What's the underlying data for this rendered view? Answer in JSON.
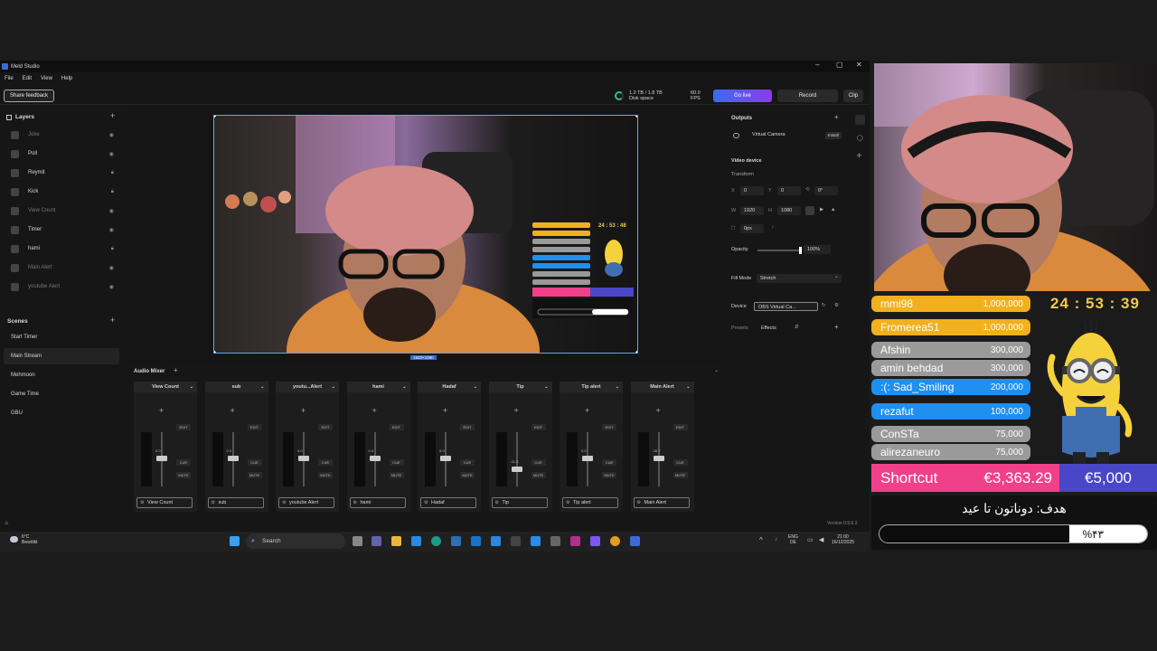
{
  "window": {
    "title": "Meld Studio",
    "min": "–",
    "max": "▢",
    "close": "✕"
  },
  "menu": [
    "File",
    "Edit",
    "View",
    "Help"
  ],
  "toolbar": {
    "share_feedback": "Share feedback",
    "disk_value": "1.2 TB / 1.8 TB",
    "disk_label": "Disk space",
    "fps_value": "60.0",
    "fps_label": "FPS",
    "go_live": "Go live",
    "record": "Record",
    "clip": "Clip"
  },
  "layers": {
    "title": "Layers",
    "items": [
      {
        "label": "Joke",
        "dim": true
      },
      {
        "label": "Poll",
        "dim": false
      },
      {
        "label": "Reymit",
        "dim": false,
        "lock": true
      },
      {
        "label": "Kick",
        "dim": false,
        "lock": true
      },
      {
        "label": "View Count",
        "dim": true
      },
      {
        "label": "Timer",
        "dim": false
      },
      {
        "label": "hami",
        "dim": false,
        "lock": true
      },
      {
        "label": "Main Alert",
        "dim": true
      },
      {
        "label": "youtube Alert",
        "dim": true
      }
    ]
  },
  "scenes": {
    "title": "Scenes",
    "items": [
      "Start Timer",
      "Main Stream",
      "Mehmoon",
      "Game Time",
      "GBU"
    ],
    "active_index": 1
  },
  "preview": {
    "size": "1920×1080",
    "timer": "24 : 53 : 48"
  },
  "mixer": {
    "title": "Audio Mixer",
    "edit": "EDIT",
    "cue": "CUE",
    "mute": "MUTE",
    "channels": [
      {
        "header": "View Count",
        "name": "View Count",
        "db": "0.0"
      },
      {
        "header": "sub",
        "name": "sub",
        "db": "0.0"
      },
      {
        "header": "youtu...Alert",
        "name": "youtube Alert",
        "db": "0.0"
      },
      {
        "header": "hami",
        "name": "hami",
        "db": "0.0"
      },
      {
        "header": "Hadaf",
        "name": "Hadaf",
        "db": "0.0"
      },
      {
        "header": "Tip",
        "name": "Tip",
        "db": "-11.3"
      },
      {
        "header": "Tip alert",
        "name": "Tip alert",
        "db": "0.0"
      },
      {
        "header": "Main Alert",
        "name": "Main Alert",
        "db": "-16.7"
      }
    ]
  },
  "props": {
    "outputs": "Outputs",
    "virtual_camera": "Virtual Camera",
    "install": "Install",
    "video_device": "Video device",
    "transform": "Transform",
    "x_label": "X",
    "x": "0",
    "y_label": "Y",
    "y": "0",
    "rot": "0°",
    "w_label": "W",
    "w": "1920",
    "h_label": "H",
    "h": "1080",
    "crop": "0px",
    "opacity_label": "Opacity",
    "opacity": "100%",
    "fill_mode_label": "Fill Mode",
    "fill_mode": "Stretch",
    "device_label": "Device",
    "device": "OBS Virtual Ca...",
    "presets": "Presets",
    "effects": "Effects",
    "version": "Version 0.9.6.3"
  },
  "taskbar": {
    "temp": "6°C",
    "weather": "Bewölkt",
    "search": "Search",
    "lang1": "ENG",
    "lang2": "DE",
    "time": "21:00",
    "date": "16/12/2025"
  },
  "overlay": {
    "timer": "24 : 53 : 39",
    "leaders": [
      {
        "name": "mmi98",
        "amount": "1,000,000",
        "color": "#f2b01e"
      },
      {
        "name": "Fromerea51",
        "amount": "1,000,000",
        "color": "#f2b01e"
      },
      {
        "name": "Afshin",
        "amount": "300,000",
        "color": "#9a9a9a"
      },
      {
        "name": "amin behdad",
        "amount": "300,000",
        "color": "#9a9a9a"
      },
      {
        "name": ":(: Sad_Smiling",
        "amount": "200,000",
        "color": "#1f8ff0"
      },
      {
        "name": "rezafut",
        "amount": "100,000",
        "color": "#1f8ff0"
      },
      {
        "name": "ConSTa",
        "amount": "75,000",
        "color": "#9a9a9a"
      },
      {
        "name": "alirezaneuro",
        "amount": "75,000",
        "color": "#9a9a9a"
      }
    ],
    "shortcut_label": "Shortcut",
    "shortcut_amount": "€3,363.29",
    "goal_amount": "€5,000",
    "goal_title": "هدف: دوناتون تا عید",
    "goal_percent": "%۴۳",
    "goal_fraction": 0.43,
    "colors": {
      "pink": "#f0408a",
      "blue": "#4a46c8"
    }
  }
}
